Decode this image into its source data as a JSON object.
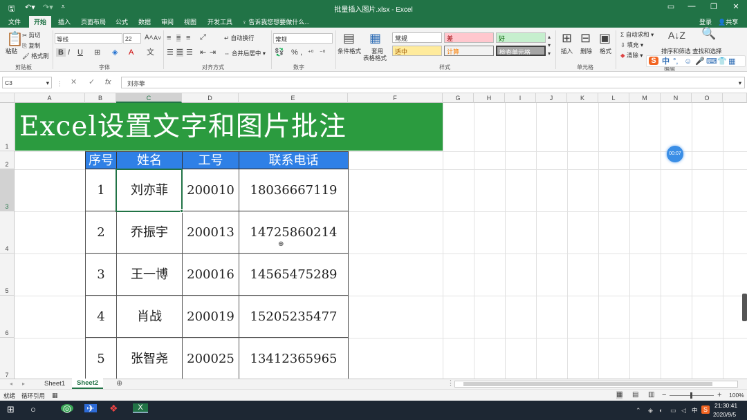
{
  "window": {
    "title": "批量插入图片.xlsx - Excel",
    "login": "登录",
    "share": "共享"
  },
  "tabs": [
    "文件",
    "开始",
    "插入",
    "页面布局",
    "公式",
    "数据",
    "审阅",
    "视图",
    "开发工具"
  ],
  "tell_me": "告诉我您想要做什么...",
  "ribbon": {
    "clipboard": {
      "paste": "粘贴",
      "cut": "剪切",
      "copy": "复制",
      "format_painter": "格式刷",
      "group": "剪贴板"
    },
    "font": {
      "name": "等线",
      "size": "22",
      "bold": "B",
      "italic": "I",
      "underline": "U",
      "group": "字体"
    },
    "alignment": {
      "wrap": "自动换行",
      "merge": "合并后居中",
      "group": "对齐方式"
    },
    "number": {
      "format": "常规",
      "group": "数字"
    },
    "styles": {
      "conditional": "条件格式",
      "table": "套用",
      "table2": "表格格式",
      "normal": "常规",
      "bad": "差",
      "good": "好",
      "neutral": "适中",
      "calc": "计算",
      "check": "检查单元格",
      "group": "样式"
    },
    "cells": {
      "insert": "插入",
      "delete": "删除",
      "format": "格式",
      "group": "单元格"
    },
    "editing": {
      "autosum": "自动求和",
      "fill": "填充",
      "clear": "清除",
      "sort": "排序和筛选",
      "find": "查找和选择",
      "group": "编辑"
    }
  },
  "formula_bar": {
    "name_box": "C3",
    "formula": "刘亦菲"
  },
  "columns": [
    "A",
    "B",
    "C",
    "D",
    "E",
    "F",
    "G",
    "H",
    "I",
    "J",
    "K",
    "L",
    "M",
    "N",
    "O"
  ],
  "rows": [
    "1",
    "2",
    "3",
    "4",
    "5",
    "6",
    "7"
  ],
  "banner_title": "Excel设置文字和图片批注",
  "table": {
    "headers": [
      "序号",
      "姓名",
      "工号",
      "联系电话"
    ],
    "rows": [
      [
        "1",
        "刘亦菲",
        "200010",
        "18036667119"
      ],
      [
        "2",
        "乔振宇",
        "200013",
        "14725860214"
      ],
      [
        "3",
        "王一博",
        "200016",
        "14565475289"
      ],
      [
        "4",
        "肖战",
        "200019",
        "15205235477"
      ],
      [
        "5",
        "张智尧",
        "200025",
        "13412365965"
      ]
    ]
  },
  "timer_badge": "00:07",
  "sheets": [
    "Sheet1",
    "Sheet2"
  ],
  "status": {
    "ready": "就绪",
    "circular": "循环引用",
    "zoom": "100%"
  },
  "taskbar": {
    "time": "21:30:41",
    "date": "2020/9/5",
    "ime": "中"
  },
  "colors": {
    "excel_green": "#217346",
    "banner": "#2b9b3f",
    "header_blue": "#2f80e6"
  }
}
